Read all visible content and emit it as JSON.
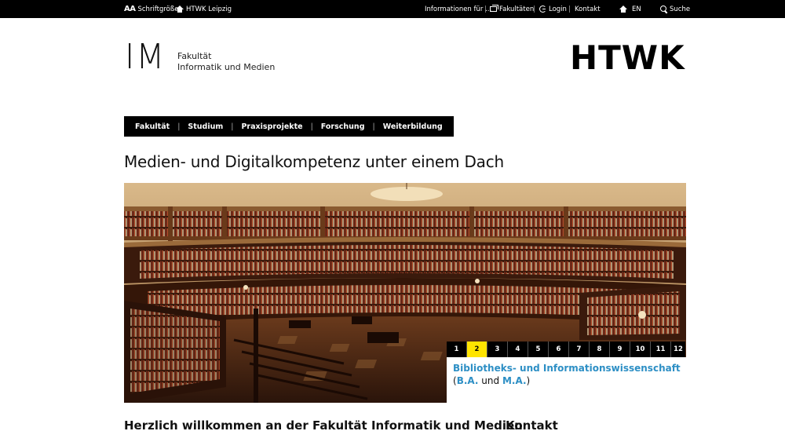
{
  "topbar": {
    "font_size_aa": "AA",
    "font_size_label": "Schriftgröße",
    "home_label": "HTWK Leipzig",
    "info_label": "Informationen für ...",
    "faculties_label": "Fakultäten",
    "login_label": "Login",
    "contact_label": "Kontakt",
    "lang_label": "EN",
    "search_label": "Suche"
  },
  "header": {
    "im_mark": "IM",
    "faculty_line1": "Fakultät",
    "faculty_line2": "Informatik und Medien",
    "htwk_logo": "HTWK"
  },
  "mainnav": {
    "items": [
      {
        "label": "Fakultät"
      },
      {
        "label": "Studium"
      },
      {
        "label": "Praxisprojekte"
      },
      {
        "label": "Forschung"
      },
      {
        "label": "Weiterbildung"
      }
    ],
    "separator": "|"
  },
  "page_title": "Medien- und Digitalkompetenz unter einem Dach",
  "slider": {
    "pages": [
      "1",
      "2",
      "3",
      "4",
      "5",
      "6",
      "7",
      "8",
      "9",
      "10",
      "11",
      "12"
    ],
    "active_page": "2",
    "caption_title": "Bibliotheks- und Informationswissenschaft",
    "caption_open": "(",
    "caption_ba": "B.A.",
    "caption_and": " und ",
    "caption_ma": "M.A.",
    "caption_close": ")"
  },
  "sections": {
    "welcome": "Herzlich willkommen an der Fakultät Informatik und Medien",
    "contact": "Kontakt"
  },
  "colors": {
    "accent_blue": "#2d8fc5",
    "active_yellow": "#ffe400",
    "bar_black": "#000000"
  }
}
